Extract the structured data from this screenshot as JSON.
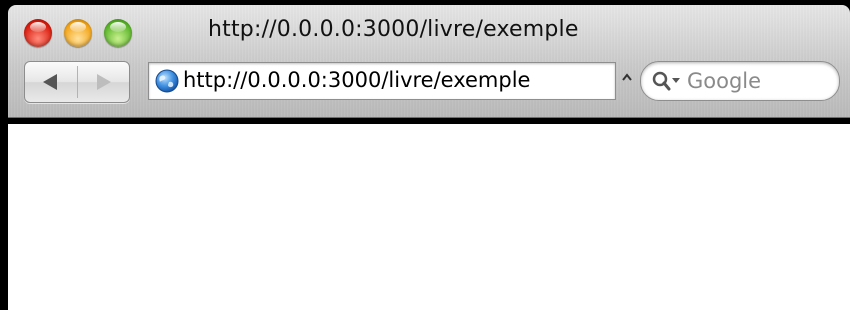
{
  "window": {
    "title": "http://0.0.0.0:3000/livre/exemple",
    "buttons": [
      "close",
      "minimize",
      "zoom"
    ]
  },
  "toolbar": {
    "back_icon": "back-arrow-icon",
    "forward_icon": "forward-arrow-icon",
    "address": {
      "icon": "globe-icon",
      "value": "http://0.0.0.0:3000/livre/exemple"
    },
    "search": {
      "icon": "search-icon",
      "placeholder": "Google"
    }
  },
  "page": {
    "background": "#ffffff"
  },
  "colors": {
    "close": "#d91d0e",
    "minimize": "#f2a418",
    "zoom": "#5bb52a"
  }
}
